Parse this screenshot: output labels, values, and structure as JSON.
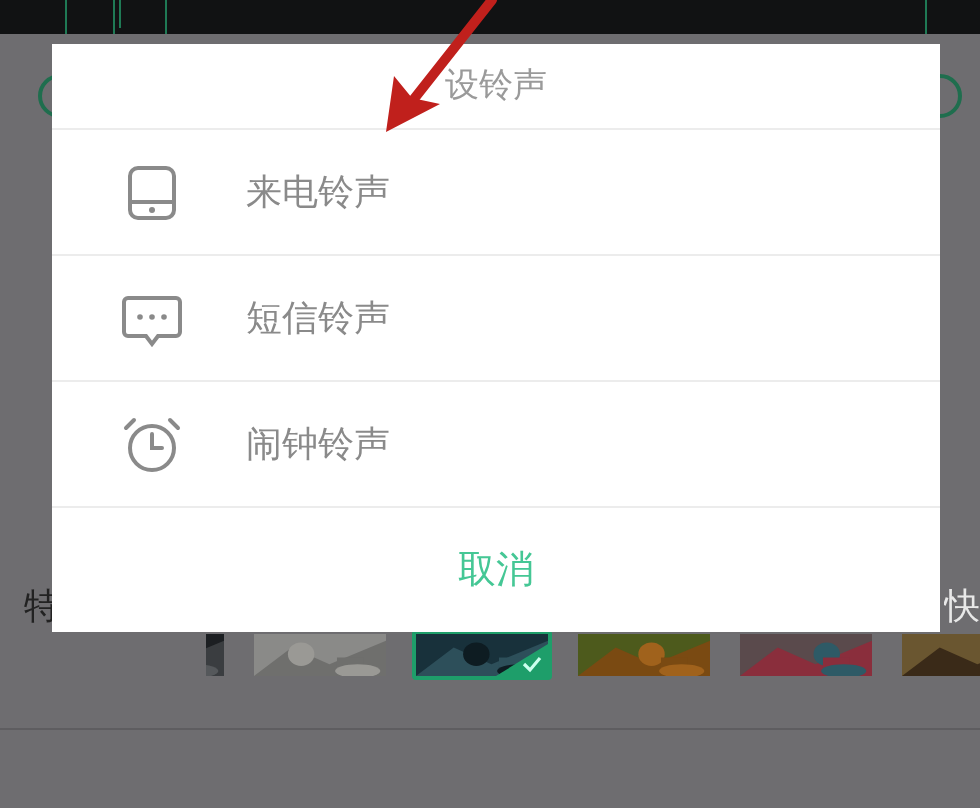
{
  "background": {
    "left_label": "特",
    "right_label": "快",
    "thumbnails": [
      {
        "selected": false
      },
      {
        "selected": false
      },
      {
        "selected": true
      },
      {
        "selected": false
      },
      {
        "selected": false
      },
      {
        "selected": false
      }
    ]
  },
  "dialog": {
    "title": "设铃声",
    "options": [
      {
        "kind": "phone",
        "label": "来电铃声"
      },
      {
        "kind": "message",
        "label": "短信铃声"
      },
      {
        "kind": "alarm",
        "label": "闹钟铃声"
      }
    ],
    "cancel": "取消"
  }
}
